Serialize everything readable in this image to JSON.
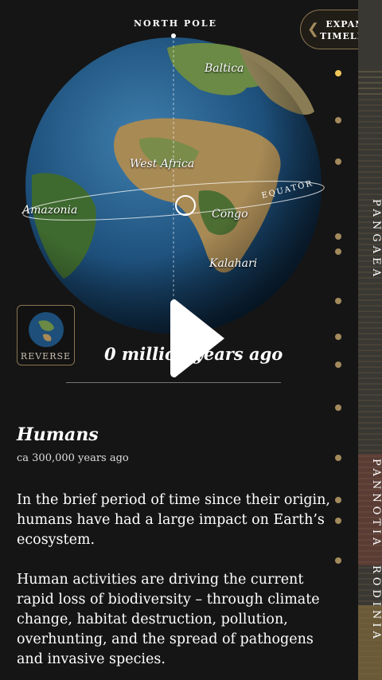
{
  "globe": {
    "north_pole_label": "NORTH POLE",
    "equator_label": "EQUATOR",
    "place_labels": [
      "Baltica",
      "West Africa",
      "Amazonia",
      "Congo",
      "Kalahari"
    ]
  },
  "expand_button": {
    "line1": "EXPAND",
    "line2": "TIMELINE"
  },
  "reverse_button": {
    "label": "REVERSE"
  },
  "age_display": "0 million years ago",
  "event": {
    "title": "Humans",
    "date": "ca 300,000 years ago",
    "paragraph1": "In the brief period of time since their origin, humans have had a large impact on Earth’s ecosystem.",
    "paragraph2": "Human activities are driving the current rapid loss of biodiversity – through climate change, habitat destruction, pollution, overhunting, and the spread of pathogens and invasive species."
  },
  "timeline": {
    "eras": [
      "PANGAEA",
      "PANNOTIA",
      "RODINIA"
    ],
    "dot_count": 13,
    "active_dot_index": 0
  },
  "colors": {
    "background": "#151515",
    "accent_gold": "#a38a5c",
    "active_dot": "#f0c658",
    "ocean": "#1d4f7a",
    "land_green": "#5a7a3a",
    "land_tan": "#a88a55"
  },
  "icons": {
    "play": "play-icon",
    "chevron": "chevron-left-icon"
  }
}
